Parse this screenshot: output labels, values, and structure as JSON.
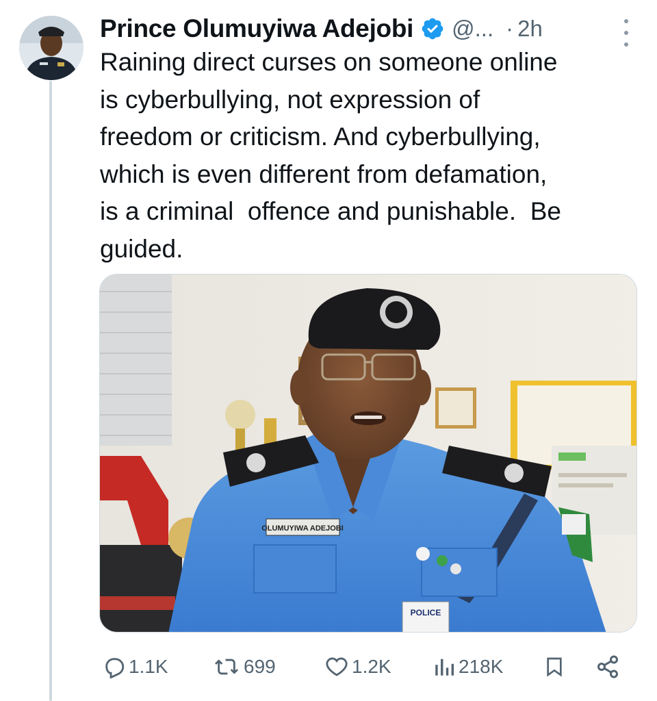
{
  "tweet": {
    "author_name": "Prince Olumuyiwa Adejobi",
    "handle": "@...",
    "separator": "·",
    "time": "2h",
    "text": "Raining direct curses on someone online\nis cyberbullying, not expression of\nfreedom or criticism. And cyberbullying,\nwhich is even different from defamation,\nis a criminal  offence and punishable.  Be\nguided."
  },
  "media": {
    "name_tag": "OLUMUYIWA  ADEJOBI",
    "id_card": "POLICE"
  },
  "actions": {
    "replies": "1.1K",
    "reposts": "699",
    "likes": "1.2K",
    "views": "218K"
  },
  "icons": {
    "verified": "verified-badge-icon",
    "more": "more-options-icon",
    "reply": "reply-icon",
    "repost": "repost-icon",
    "like": "heart-icon",
    "views": "views-chart-icon",
    "bookmark": "bookmark-icon",
    "share": "share-icon"
  },
  "colors": {
    "text_primary": "#0f1419",
    "text_secondary": "#536471",
    "verified_blue": "#1d9bf0",
    "thread_line": "#cfd9de"
  }
}
